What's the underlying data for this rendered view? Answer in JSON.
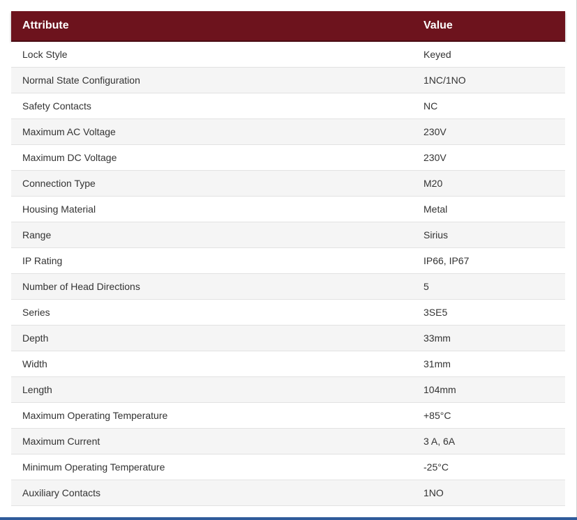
{
  "table": {
    "headers": {
      "attribute": "Attribute",
      "value": "Value"
    },
    "rows": [
      {
        "attribute": "Lock Style",
        "value": "Keyed"
      },
      {
        "attribute": "Normal State Configuration",
        "value": "1NC/1NO"
      },
      {
        "attribute": "Safety Contacts",
        "value": "NC"
      },
      {
        "attribute": "Maximum AC Voltage",
        "value": "230V"
      },
      {
        "attribute": "Maximum DC Voltage",
        "value": "230V"
      },
      {
        "attribute": "Connection Type",
        "value": "M20"
      },
      {
        "attribute": "Housing Material",
        "value": "Metal"
      },
      {
        "attribute": "Range",
        "value": "Sirius"
      },
      {
        "attribute": "IP Rating",
        "value": "IP66, IP67"
      },
      {
        "attribute": "Number of Head Directions",
        "value": "5"
      },
      {
        "attribute": "Series",
        "value": "3SE5"
      },
      {
        "attribute": "Depth",
        "value": "33mm"
      },
      {
        "attribute": "Width",
        "value": "31mm"
      },
      {
        "attribute": "Length",
        "value": "104mm"
      },
      {
        "attribute": "Maximum Operating Temperature",
        "value": "+85°C"
      },
      {
        "attribute": "Maximum Current",
        "value": "3 A, 6A"
      },
      {
        "attribute": "Minimum Operating Temperature",
        "value": "-25°C"
      },
      {
        "attribute": "Auxiliary Contacts",
        "value": "1NO"
      }
    ]
  },
  "colors": {
    "header_bg": "#6d131d",
    "header_text": "#ffffff",
    "row_alt_bg": "#f5f5f5",
    "bottom_bar": "#2f5b9a"
  }
}
